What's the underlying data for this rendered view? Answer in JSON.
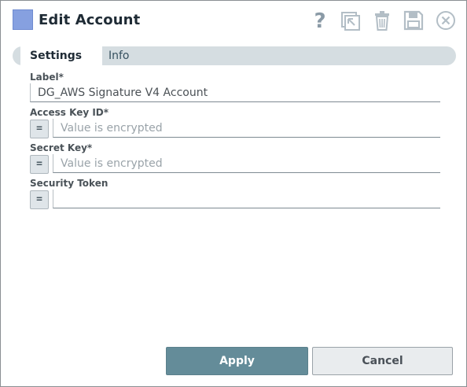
{
  "header": {
    "title": "Edit Account",
    "icons": [
      "app-icon",
      "help-icon",
      "open-in-new-icon",
      "trash-icon",
      "save-icon",
      "close-icon"
    ]
  },
  "tabs": [
    {
      "label": "Settings",
      "active": true
    },
    {
      "label": "Info",
      "active": false
    }
  ],
  "form": {
    "label_field": {
      "label": "Label*",
      "value": "DG_AWS Signature V4 Account"
    },
    "access_key": {
      "label": "Access Key ID*",
      "placeholder": "Value is encrypted",
      "expr_label": "="
    },
    "secret_key": {
      "label": "Secret Key*",
      "placeholder": "Value is encrypted",
      "expr_label": "="
    },
    "security_token": {
      "label": "Security Token",
      "placeholder": "",
      "expr_label": "="
    }
  },
  "footer": {
    "apply_label": "Apply",
    "cancel_label": "Cancel"
  },
  "colors": {
    "primary": "#648c99",
    "app_icon": "#86a0e0",
    "tab_bar": "#d5dde1"
  }
}
